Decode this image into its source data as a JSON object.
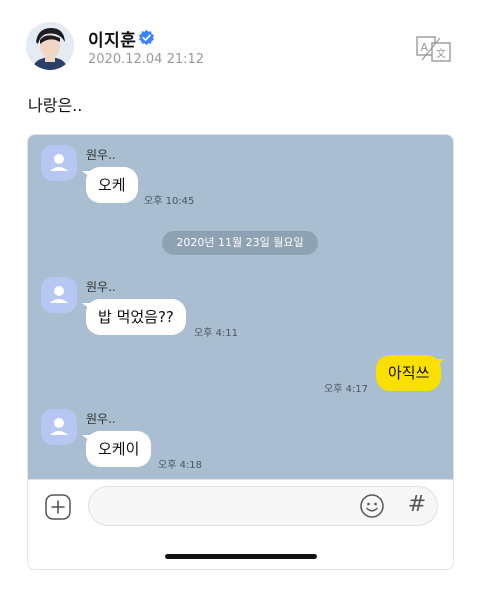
{
  "post": {
    "author": "이지훈",
    "date": "2020.12.04 21:12",
    "text": "나랑은..",
    "icons": {
      "verified": "verified-badge-icon",
      "translate": "translate-icon"
    },
    "colors": {
      "verified": "#3b82f6"
    }
  },
  "chat": {
    "background": "#a9bed0",
    "date_divider": "2020년 11월 23일 월요일",
    "messages": [
      {
        "sender": "원우..",
        "text": "오케",
        "time": "오후 10:45",
        "mine": false
      },
      {
        "sender": "원우..",
        "text": "밥 먹었음??",
        "time": "오후 4:11",
        "mine": false
      },
      {
        "sender": "",
        "text": "아직쓰",
        "time": "오후 4:17",
        "mine": true
      },
      {
        "sender": "원우..",
        "text": "오케이",
        "time": "오후 4:18",
        "mine": false
      }
    ],
    "input": {
      "placeholder": "",
      "hash_label": "#",
      "icons": {
        "add": "plus-circle-icon",
        "emoji": "smiley-icon",
        "hash": "hash-icon"
      }
    },
    "colors": {
      "my_bubble": "#f9e000",
      "their_bubble": "#ffffff",
      "avatar": "#b8c6f4"
    }
  }
}
